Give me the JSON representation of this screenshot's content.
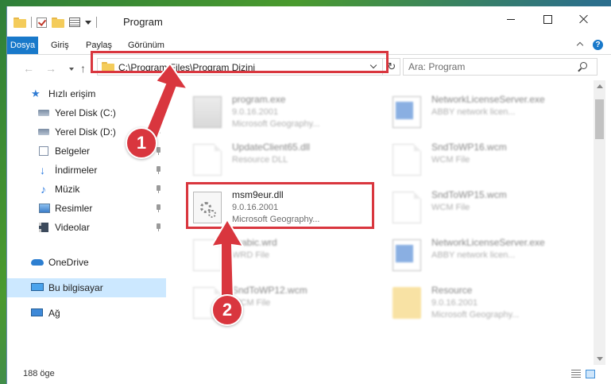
{
  "window": {
    "title": "Program",
    "colors": {
      "accent": "#1979ca",
      "highlight": "#d9363e",
      "selection": "#cce8ff"
    }
  },
  "ribbon": {
    "tabs": [
      "Dosya",
      "Giriş",
      "Paylaş",
      "Görünüm"
    ],
    "help": "?"
  },
  "nav": {
    "back": "←",
    "forward": "→",
    "up": "↑",
    "address": "C:\\Program Files\\Program Dizini",
    "refresh": "↻",
    "search_placeholder": "Ara: Program"
  },
  "sidebar": {
    "items": [
      {
        "label": "Hızlı erişim",
        "icon": "star-icon",
        "pinned": false
      },
      {
        "label": "Yerel Disk (C:)",
        "icon": "disk-icon",
        "pinned": true
      },
      {
        "label": "Yerel Disk (D:)",
        "icon": "disk-icon",
        "pinned": true
      },
      {
        "label": "Belgeler",
        "icon": "documents-icon",
        "pinned": true
      },
      {
        "label": "İndirmeler",
        "icon": "download-icon",
        "pinned": true
      },
      {
        "label": "Müzik",
        "icon": "music-icon",
        "pinned": true
      },
      {
        "label": "Resimler",
        "icon": "pictures-icon",
        "pinned": true
      },
      {
        "label": "Videolar",
        "icon": "videos-icon",
        "pinned": true
      },
      {
        "label": "OneDrive",
        "icon": "cloud-icon",
        "pinned": false
      },
      {
        "label": "Bu bilgisayar",
        "icon": "computer-icon",
        "pinned": false,
        "selected": true
      },
      {
        "label": "Ağ",
        "icon": "network-icon",
        "pinned": false
      }
    ]
  },
  "files": [
    {
      "name": "program.exe",
      "line1": "9.0.16.2001",
      "line2": "Microsoft Geography...",
      "icon": "setup-icon",
      "blurred": true
    },
    {
      "name": "NetworkLicenseServer.exe",
      "line1": "ABBY network licen...",
      "line2": "",
      "icon": "app-icon",
      "blurred": true
    },
    {
      "name": "UpdateClient65.dll",
      "line1": "Resource DLL",
      "line2": "",
      "icon": "document-icon",
      "blurred": true
    },
    {
      "name": "SndToWP16.wcm",
      "line1": "WCM File",
      "line2": "",
      "icon": "document-icon",
      "blurred": true
    },
    {
      "name": "msm9eur.dll",
      "line1": "9.0.16.2001",
      "line2": "Microsoft Geography...",
      "icon": "gear-icon",
      "blurred": false
    },
    {
      "name": "SndToWP15.wcm",
      "line1": "WCM File",
      "line2": "",
      "icon": "document-icon",
      "blurred": true
    },
    {
      "name": "Arabic.wrd",
      "line1": "WRD File",
      "line2": "",
      "icon": "document-icon",
      "blurred": true
    },
    {
      "name": "NetworkLicenseServer.exe",
      "line1": "ABBY network licen...",
      "line2": "",
      "icon": "app-icon",
      "blurred": true
    },
    {
      "name": "SndToWP12.wcm",
      "line1": "WCM File",
      "line2": "",
      "icon": "document-icon",
      "blurred": true
    },
    {
      "name": "Resource",
      "line1": "9.0.16.2001",
      "line2": "Microsoft Geography...",
      "icon": "folder-icon",
      "blurred": true
    }
  ],
  "status": {
    "count": "188 öge"
  },
  "callouts": {
    "one": "1",
    "two": "2"
  }
}
